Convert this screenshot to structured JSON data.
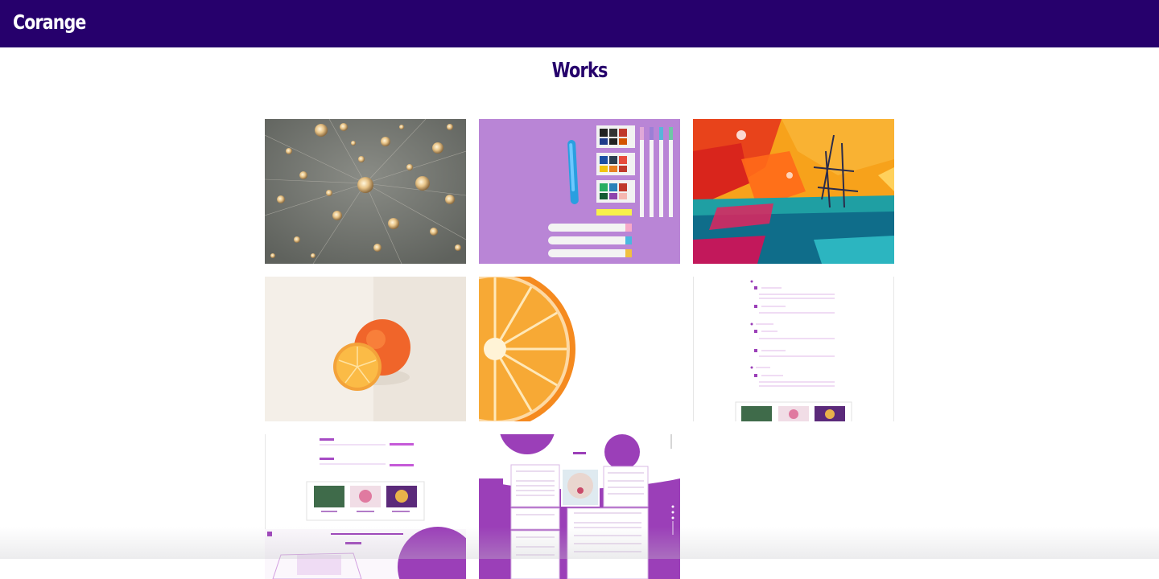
{
  "header": {
    "brand": "Corange",
    "background": "#26006c"
  },
  "main": {
    "title": "Works",
    "title_color": "#26006c",
    "works": [
      {
        "id": "work-1",
        "subject": "light-bulbs"
      },
      {
        "id": "work-2",
        "subject": "art-supplies"
      },
      {
        "id": "work-3",
        "subject": "abstract-painting"
      },
      {
        "id": "work-4",
        "subject": "orange"
      },
      {
        "id": "work-5",
        "subject": "orange-slice"
      },
      {
        "id": "work-6",
        "subject": "site-screenshot-faq"
      },
      {
        "id": "work-7",
        "subject": "site-screenshot-menu"
      },
      {
        "id": "work-8",
        "subject": "site-screenshot-purple"
      }
    ]
  }
}
